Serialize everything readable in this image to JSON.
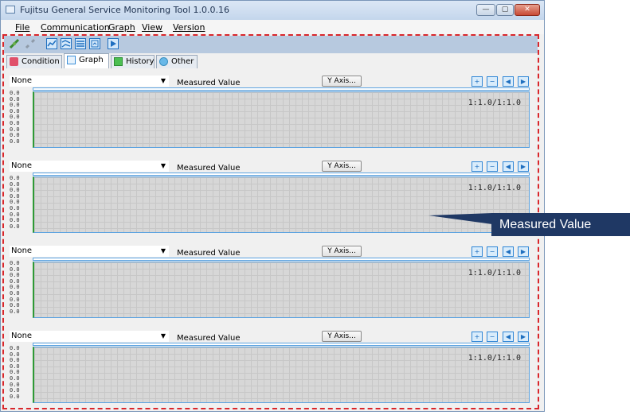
{
  "window": {
    "title": "Fujitsu General Service Monitoring Tool 1.0.0.16",
    "buttons": {
      "minimize": "—",
      "maximize": "▢",
      "close": "✕"
    }
  },
  "menu": [
    "File",
    "Communication",
    "Graph",
    "View",
    "Version"
  ],
  "tabs": [
    {
      "label": "Condition",
      "icon": "condition-icon",
      "active": false
    },
    {
      "label": "Graph",
      "icon": "graph-icon",
      "active": true
    },
    {
      "label": "History",
      "icon": "history-icon",
      "active": false
    },
    {
      "label": "Other",
      "icon": "other-icon",
      "active": false
    }
  ],
  "toolbar_icons": [
    "connect-icon",
    "disconnect-icon",
    "graph-mode-icon",
    "graph-split-icon",
    "list-icon",
    "data-icon",
    "play-icon"
  ],
  "panels": [
    {
      "select_value": "None",
      "measured_label": "Measured Value",
      "yaxis_button": "Y Axis...",
      "ratio": "1:1.0/1:1.0",
      "y_ticks": [
        "0.0",
        "0.0",
        "0.0",
        "0.0",
        "0.0",
        "0.0",
        "0.0",
        "0.0",
        "0.0"
      ]
    },
    {
      "select_value": "None",
      "measured_label": "Measured Value",
      "yaxis_button": "Y Axis...",
      "ratio": "1:1.0/1:1.0",
      "y_ticks": [
        "0.0",
        "0.0",
        "0.0",
        "0.0",
        "0.0",
        "0.0",
        "0.0",
        "0.0",
        "0.0"
      ]
    },
    {
      "select_value": "None",
      "measured_label": "Measured Value",
      "yaxis_button": "Y Axis...",
      "ratio": "1:1.0/1:1.0",
      "y_ticks": [
        "0.0",
        "0.0",
        "0.0",
        "0.0",
        "0.0",
        "0.0",
        "0.0",
        "0.0",
        "0.0"
      ]
    },
    {
      "select_value": "None",
      "measured_label": "Measured Value",
      "yaxis_button": "Y Axis...",
      "ratio": "1:1.0/1:1.0",
      "y_ticks": [
        "0.0",
        "0.0",
        "0.0",
        "0.0",
        "0.0",
        "0.0",
        "0.0",
        "0.0",
        "0.0"
      ]
    }
  ],
  "panel_buttons": [
    "zoom-in-icon",
    "zoom-out-icon",
    "scroll-left-icon",
    "scroll-right-icon"
  ],
  "callout": {
    "text": "Measured Value"
  },
  "colors": {
    "accent": "#1f3864",
    "frame": "#d9262b",
    "plot_bg": "#d7d7d7",
    "axis_line": "#2e9a35"
  }
}
